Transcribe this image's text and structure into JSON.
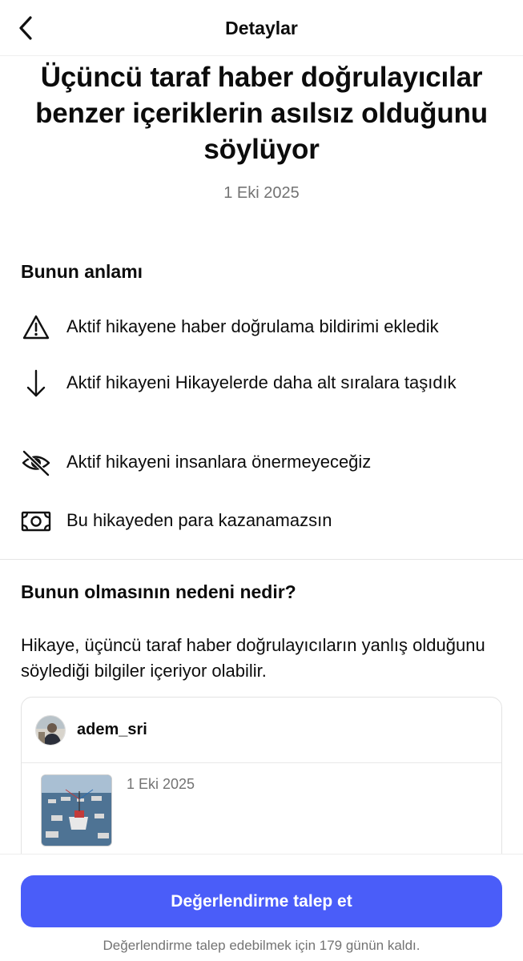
{
  "header": {
    "title": "Detaylar",
    "back_icon": "chevron-left-icon"
  },
  "headline": "Üçüncü taraf haber doğrulayıcılar benzer içeriklerin asılsız olduğunu söylüyor",
  "date": "1 Eki 2025",
  "meaning": {
    "title": "Bunun anlamı",
    "items": [
      {
        "icon": "warning-triangle-icon",
        "text": "Aktif hikayene haber doğrulama bildirimi ekledik"
      },
      {
        "icon": "arrow-down-icon",
        "text": "Aktif hikayeni Hikayelerde daha alt sıralara taşıdık"
      },
      {
        "icon": "eye-off-icon",
        "text": "Aktif hikayeni insanlara önermeyeceğiz"
      },
      {
        "icon": "money-bill-icon",
        "text": "Bu hikayeden para kazanamazsın"
      }
    ]
  },
  "reason": {
    "title": "Bunun olmasının nedeni nedir?",
    "text": "Hikaye, üçüncü taraf haber doğrulayıcıların yanlış olduğunu söylediği bilgiler içeriyor olabilir."
  },
  "post": {
    "username": "adem_sri",
    "date": "1 Eki 2025"
  },
  "footer": {
    "button_label": "Değerlendirme talep et",
    "note": "Değerlendirme talep edebilmek için 179 günün kaldı."
  },
  "colors": {
    "accent": "#4a5df9",
    "secondary_text": "#737373"
  }
}
